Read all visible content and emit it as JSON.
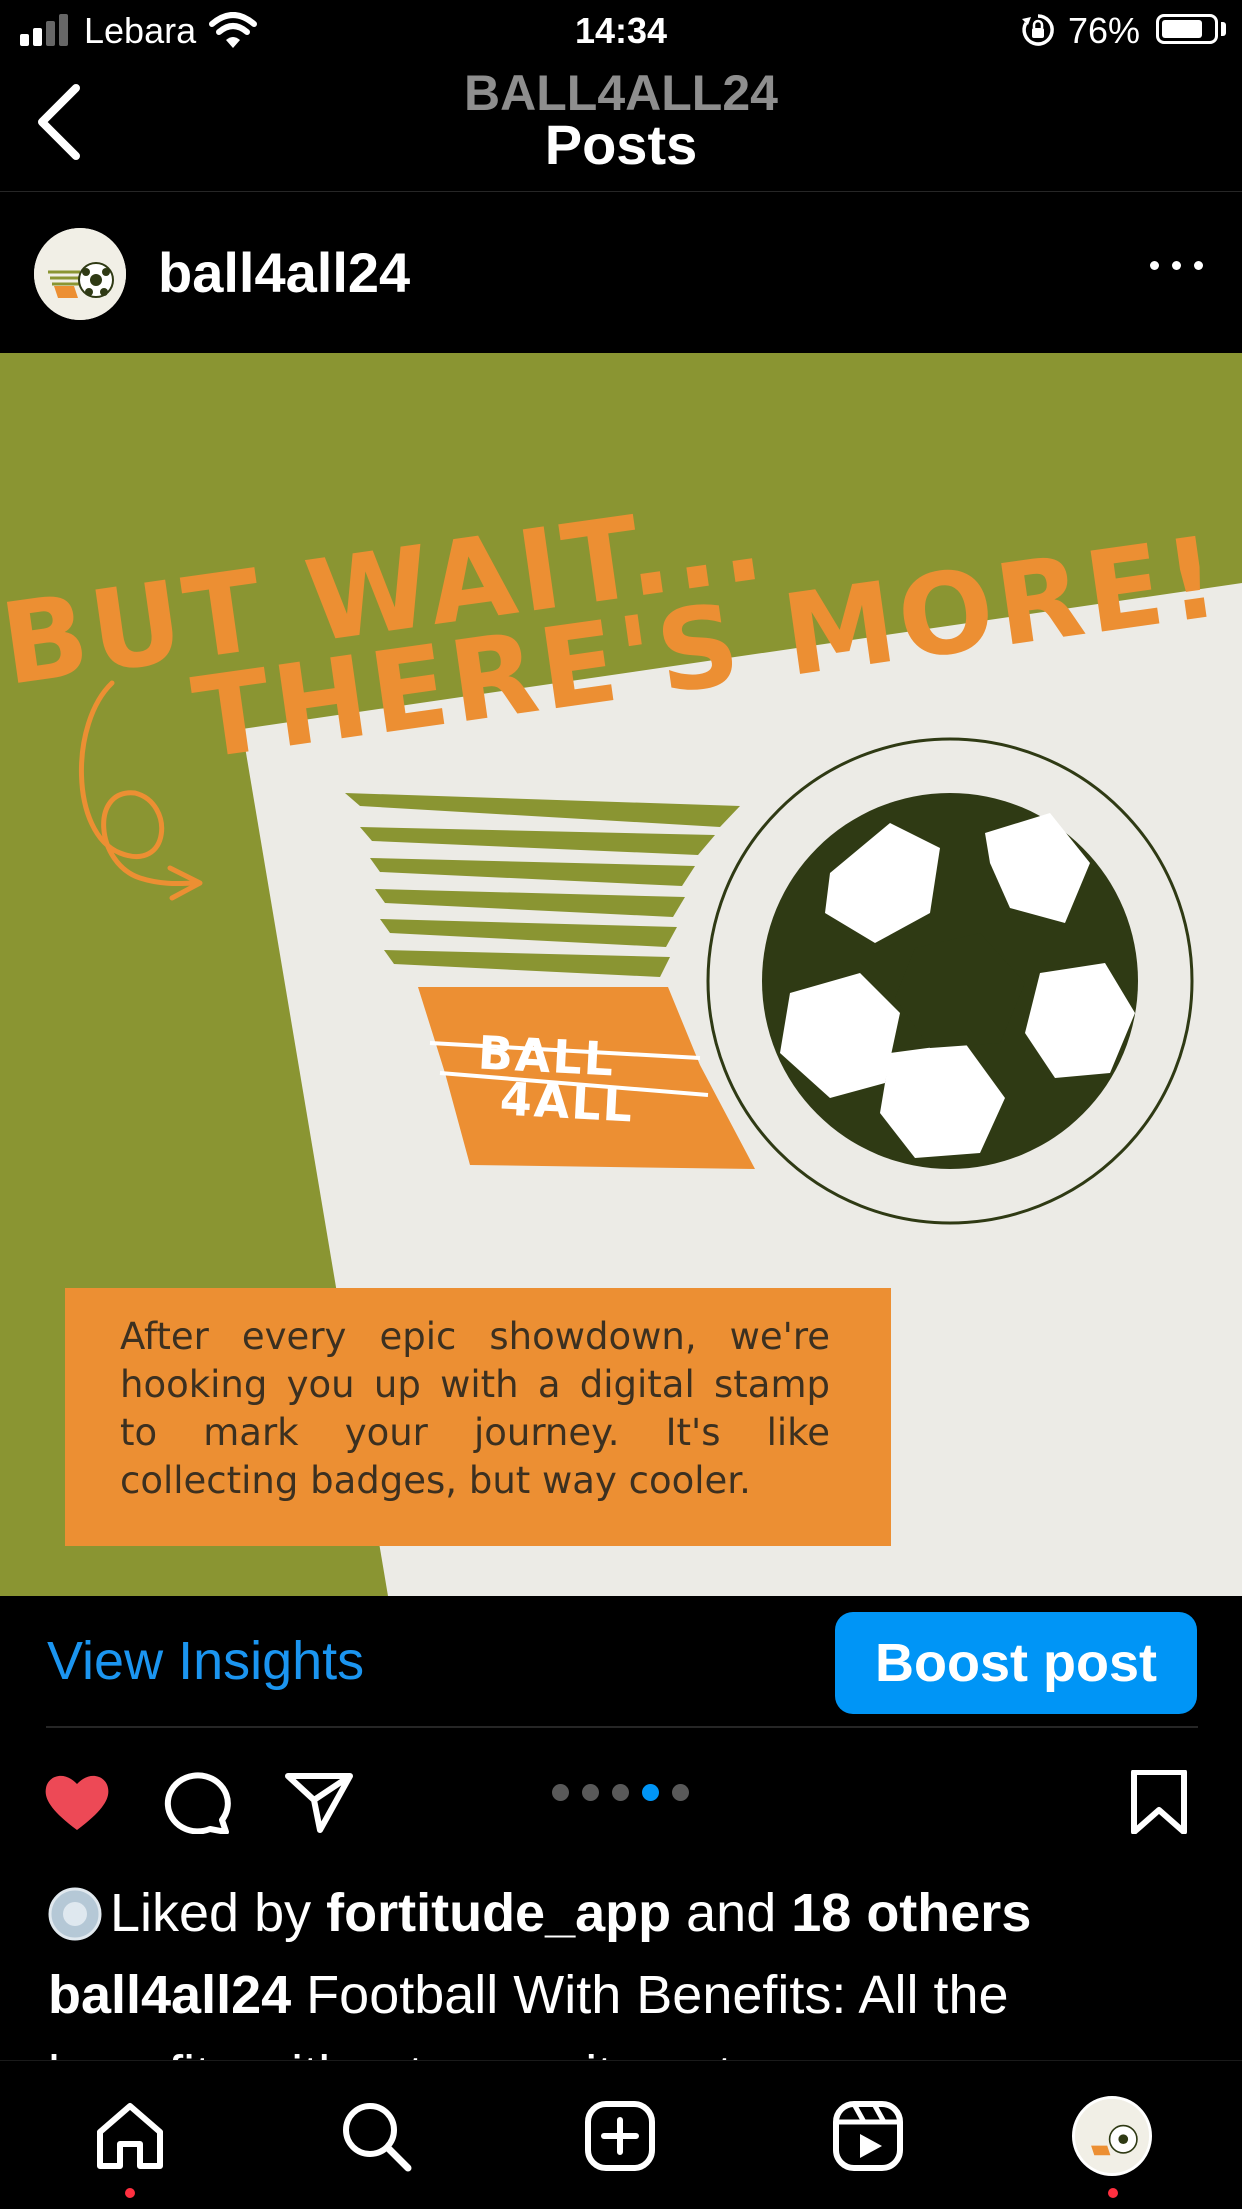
{
  "status_bar": {
    "carrier": "Lebara",
    "time": "14:34",
    "battery": "76%"
  },
  "nav": {
    "username": "BALL4ALL24",
    "title": "Posts"
  },
  "post": {
    "username": "ball4all24",
    "image": {
      "headline_line1": "BUT WAIT...",
      "headline_line2": "THERE'S MORE!",
      "logo_line1": "BALL",
      "logo_line2": "4ALL",
      "body": "After every epic showdown, we're hooking you up with a digital stamp to mark your journey. It's like collecting badges, but way cooler."
    },
    "view_insights": "View Insights",
    "boost_post": "Boost post",
    "carousel": {
      "total": 5,
      "active_index": 3
    },
    "liked_prefix": "Liked by ",
    "liked_user": "fortitude_app",
    "liked_and": " and ",
    "liked_others": "18 others",
    "caption_user": "ball4all24",
    "caption_text": " Football With Benefits: All the",
    "caption_line2": "benefits without commitment... more"
  },
  "colors": {
    "accent_blue": "#0095f6",
    "link_blue": "#1b95f0",
    "like_red": "#ed4956",
    "olive": "#8a9532",
    "orange": "#ec8f33",
    "cream": "#ecebe6",
    "ball_dark": "#2f3a14"
  },
  "icons": [
    "signal-icon",
    "wifi-icon",
    "rotation-lock-icon",
    "battery-icon",
    "back-chevron-icon",
    "more-icon",
    "heart-icon",
    "comment-icon",
    "share-icon",
    "bookmark-icon",
    "home-icon",
    "search-icon",
    "create-icon",
    "reels-icon",
    "profile-icon"
  ]
}
